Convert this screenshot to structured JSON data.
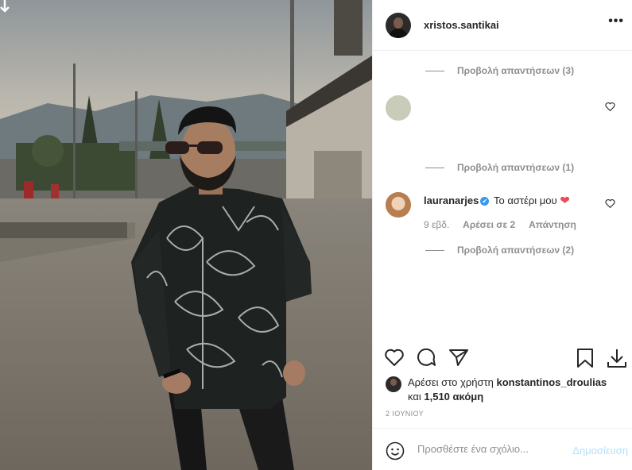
{
  "post": {
    "username": "xristos.santikai",
    "more_label": "•••"
  },
  "comments": {
    "view_replies_1": "Προβολή απαντήσεων (3)",
    "view_replies_2": "Προβολή απαντήσεων (1)",
    "view_replies_3": "Προβολή απαντήσεων (2)",
    "comment": {
      "username": "lauranarjes",
      "verified": "✔",
      "text": "Το αστέρι μου",
      "emoji": "❤",
      "time": "9 εβδ.",
      "likes": "Αρέσει σε 2",
      "reply": "Απάντηση"
    }
  },
  "likes": {
    "prefix": "Αρέσει στο χρήστη",
    "user": "konstantinos_droulias",
    "and": "και",
    "count": "1,510 ακόμη"
  },
  "date": "2 ΙΟΥΝΙΟΥ",
  "add_comment": {
    "placeholder": "Προσθέστε ένα σχόλιο...",
    "post_label": "Δημοσίευση"
  },
  "icons": {
    "corner": "download-arrow-icon",
    "like": "heart-icon",
    "comment": "comment-icon",
    "share": "paper-plane-icon",
    "save": "bookmark-icon",
    "download": "download-icon",
    "emoji": "smiley-icon"
  },
  "colors": {
    "accent_blue": "#3897f0",
    "post_disabled": "#b2dffc",
    "heart_red": "#ed4956",
    "muted": "#8e8e8e"
  }
}
